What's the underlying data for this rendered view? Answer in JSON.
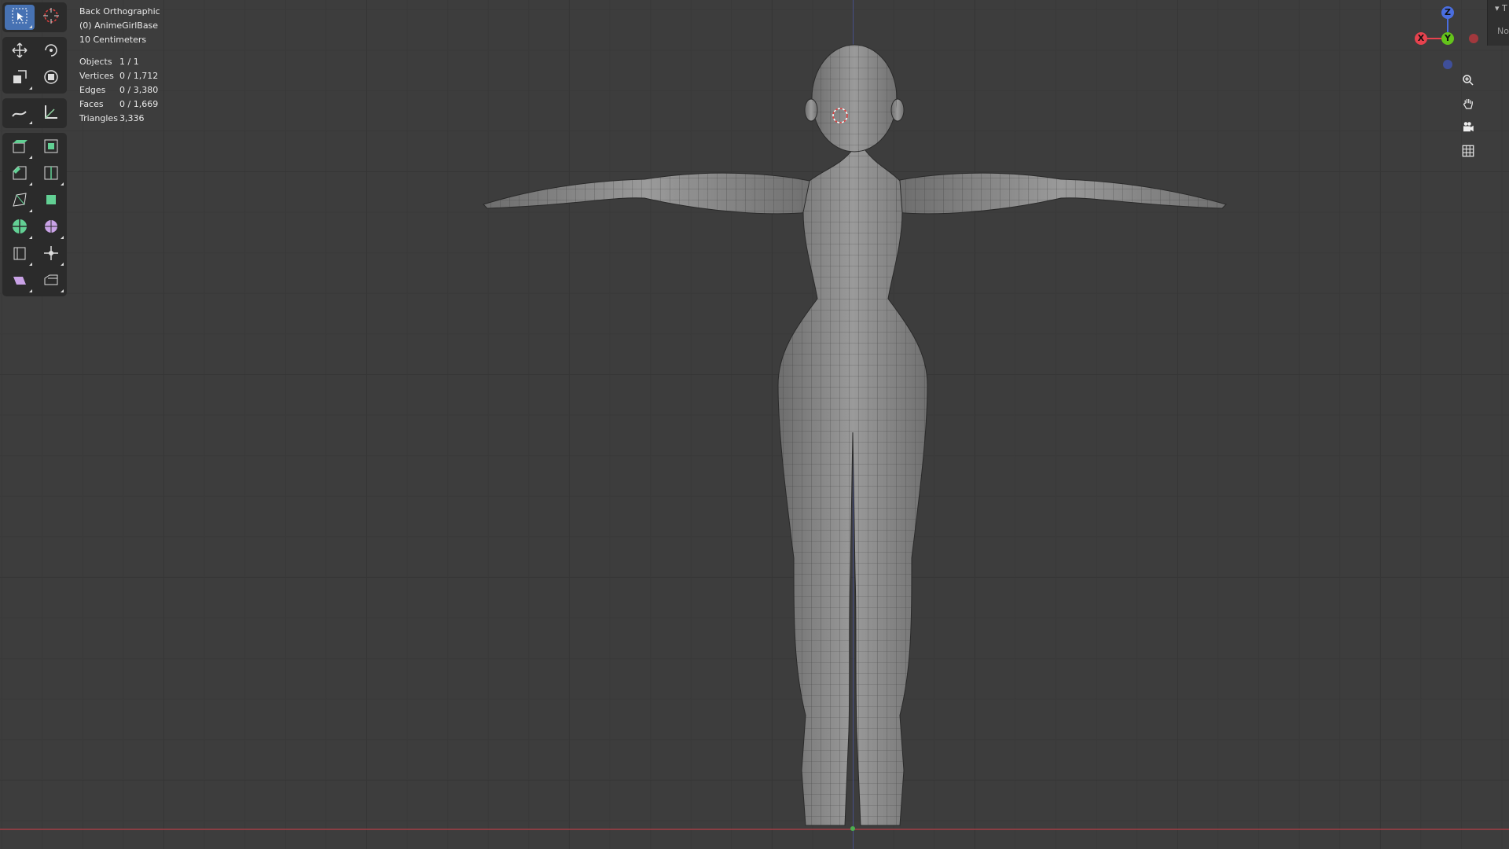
{
  "viewport": {
    "view_name": "Back Orthographic",
    "object_name": "(0) AnimeGirlBase",
    "scale": "10 Centimeters",
    "stats": [
      {
        "label": "Objects",
        "value": "1 / 1"
      },
      {
        "label": "Vertices",
        "value": "0 / 1,712"
      },
      {
        "label": "Edges",
        "value": "0 / 3,380"
      },
      {
        "label": "Faces",
        "value": "0 / 1,669"
      },
      {
        "label": "Triangles",
        "value": "3,336"
      }
    ]
  },
  "toolbar": {
    "tools": [
      [
        "select-box-icon",
        "cursor-icon"
      ],
      [
        "move-icon",
        "rotate-icon"
      ],
      [
        "scale-icon",
        "transform-icon"
      ],
      [
        "annotate-icon",
        "measure-icon"
      ],
      [
        "extrude-region-icon",
        "inset-faces-icon"
      ],
      [
        "bevel-icon",
        "loop-cut-icon"
      ],
      [
        "knife-icon",
        "poly-build-icon"
      ],
      [
        "spin-icon",
        "smooth-icon"
      ],
      [
        "edge-slide-icon",
        "shrink-fatten-icon"
      ],
      [
        "shear-icon",
        "rip-region-icon"
      ]
    ]
  },
  "gizmo": {
    "x_label": "X",
    "y_label": "Y",
    "z_label": "Z",
    "colors": {
      "x": "#e7424e",
      "y": "#64c41b",
      "z": "#4a6ee0"
    }
  },
  "nav_buttons": [
    "zoom-icon",
    "pan-hand-icon",
    "camera-icon",
    "perspective-grid-icon"
  ],
  "sidebar": {
    "tab_arrow": "▾ T",
    "tab_text": "Not"
  },
  "colors": {
    "active_tool": "#4772b3",
    "background": "#3d3d3d"
  }
}
